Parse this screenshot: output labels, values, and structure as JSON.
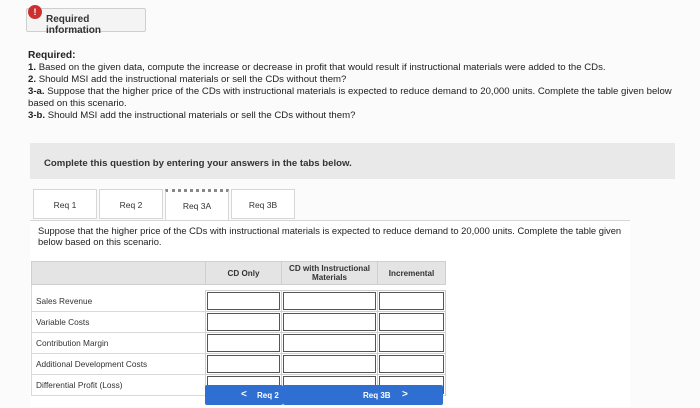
{
  "header": {
    "tab_label": "Required information",
    "alert_glyph": "!"
  },
  "required": {
    "title": "Required:",
    "items": [
      {
        "num": "1.",
        "text": "Based on the given data, compute the increase or decrease in profit that would result if instructional materials were added to the CDs."
      },
      {
        "num": "2.",
        "text": "Should MSI add the instructional materials or sell the CDs without them?"
      },
      {
        "num": "3-a.",
        "text": "Suppose that the higher price of the CDs with instructional materials is expected to reduce demand to 20,000 units. Complete the table given below based on this scenario."
      },
      {
        "num": "3-b.",
        "text": "Should MSI add the instructional materials or sell the CDs without them?"
      }
    ]
  },
  "instruction": "Complete this question by entering your answers in the tabs below.",
  "tabs": [
    "Req 1",
    "Req 2",
    "Req 3A",
    "Req 3B"
  ],
  "active_tab": "Req 3A",
  "panel": {
    "prompt": "Suppose that the higher price of the CDs with instructional materials is expected to reduce demand to 20,000 units. Complete the table given below based on this scenario.",
    "columns": [
      "CD Only",
      "CD with Instructional Materials",
      "Incremental"
    ],
    "rows": [
      "Sales Revenue",
      "Variable Costs",
      "Contribution Margin",
      "Additional Development Costs",
      "Differential Profit (Loss)"
    ]
  },
  "nav": {
    "prev_label": "Req 2",
    "next_label": "Req 3B",
    "prev_arrow": "<",
    "next_arrow": ">"
  },
  "colors": {
    "accent": "#2f6fd1",
    "alert": "#cc3030"
  }
}
